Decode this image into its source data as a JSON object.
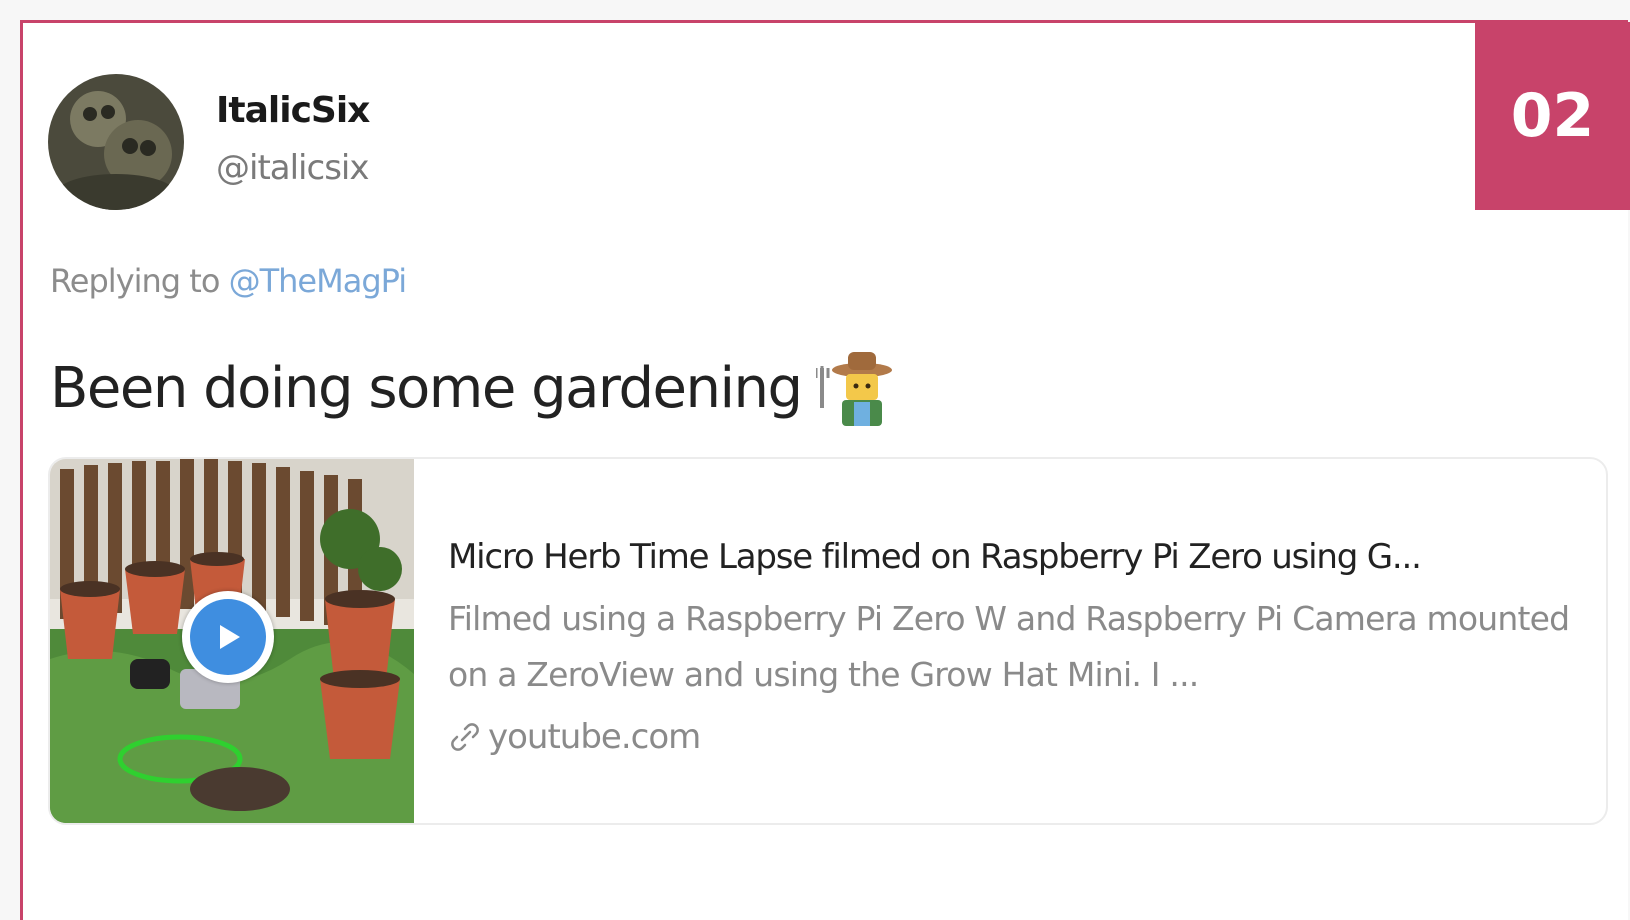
{
  "badge": {
    "number": "02"
  },
  "tweet": {
    "display_name": "ItalicSix",
    "handle": "@italicsix",
    "replying_prefix": "Replying to",
    "replying_mention": "@TheMagPi",
    "text": "Been doing some gardening"
  },
  "card": {
    "title": "Micro Herb Time Lapse filmed on Raspberry Pi Zero using G...",
    "description": "Filmed using a Raspberry Pi Zero W and Raspberry Pi Camera mounted on a ZeroView and using the Grow Hat Mini. I ...",
    "domain": "youtube.com"
  },
  "icons": {
    "avatar": "profile-photo",
    "emoji": "farmer-emoji",
    "play": "play-icon",
    "link": "link-icon"
  },
  "colors": {
    "accent": "#c8436a",
    "mention": "#7ba8d8",
    "play": "#3f8ee0"
  }
}
